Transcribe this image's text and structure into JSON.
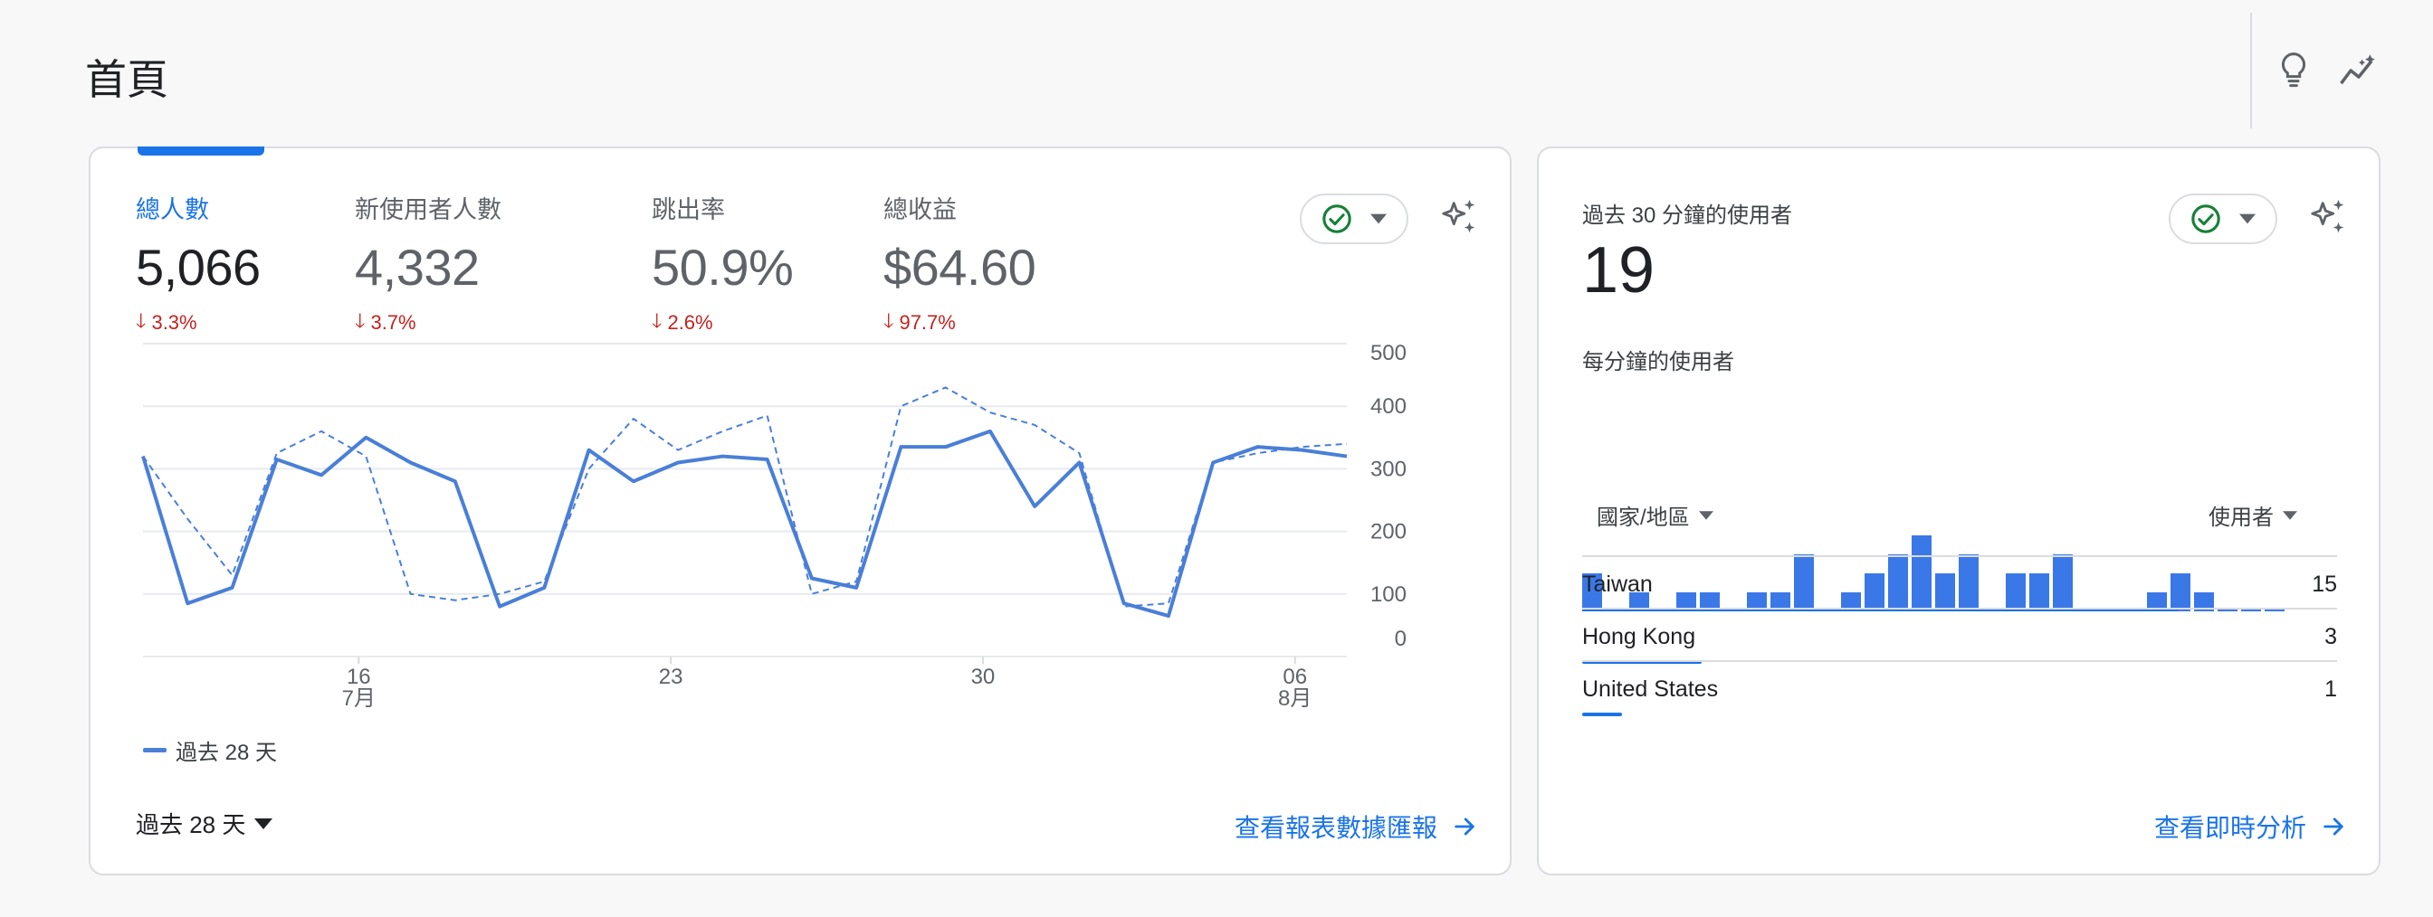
{
  "page": {
    "title": "首頁"
  },
  "header": {
    "icons": [
      "lightbulb-icon",
      "insights-icon"
    ]
  },
  "overview": {
    "metrics": [
      {
        "label": "總人數",
        "value": "5,066",
        "delta": "3.3%",
        "direction": "down",
        "active": true
      },
      {
        "label": "新使用者人數",
        "value": "4,332",
        "delta": "3.7%",
        "direction": "down",
        "active": false
      },
      {
        "label": "跳出率",
        "value": "50.9%",
        "delta": "2.6%",
        "direction": "down",
        "active": false
      },
      {
        "label": "總收益",
        "value": "$64.60",
        "delta": "97.7%",
        "direction": "down",
        "active": false
      }
    ],
    "legend": "過去 28 天",
    "date_range": "過去 28 天",
    "footer_link": "查看報表數據匯報"
  },
  "chart_data": {
    "type": "line",
    "x_tick_labels": [
      {
        "day": "16",
        "month": "7月"
      },
      {
        "day": "23",
        "month": ""
      },
      {
        "day": "30",
        "month": ""
      },
      {
        "day": "06",
        "month": "8月"
      }
    ],
    "y_ticks": [
      "500",
      "400",
      "300",
      "200",
      "100",
      "0"
    ],
    "ylim": [
      0,
      500
    ],
    "grid": true,
    "series": [
      {
        "name": "過去 28 天",
        "style": "solid",
        "values": [
          320,
          85,
          110,
          315,
          290,
          350,
          310,
          280,
          80,
          110,
          330,
          280,
          310,
          320,
          315,
          125,
          110,
          335,
          335,
          360,
          240,
          310,
          85,
          65,
          310,
          335,
          330,
          320
        ]
      },
      {
        "style": "dashed",
        "values": [
          320,
          220,
          130,
          325,
          360,
          320,
          100,
          90,
          100,
          120,
          300,
          380,
          330,
          360,
          385,
          100,
          120,
          400,
          430,
          390,
          370,
          325,
          80,
          85,
          310,
          325,
          335,
          340
        ]
      }
    ]
  },
  "realtime": {
    "label": "過去 30 分鐘的使用者",
    "value": "19",
    "per_minute_label": "每分鐘的使用者",
    "per_minute": [
      2,
      0,
      1,
      0,
      1,
      1,
      0,
      1,
      1,
      3,
      0,
      1,
      2,
      3,
      4,
      2,
      3,
      0,
      2,
      2,
      3,
      0,
      0,
      0,
      1,
      2,
      1,
      0,
      0,
      0
    ],
    "col_country": "國家/地區",
    "col_users": "使用者",
    "rows": [
      {
        "name": "Taiwan",
        "value": "15",
        "count": 15
      },
      {
        "name": "Hong Kong",
        "value": "3",
        "count": 3
      },
      {
        "name": "United States",
        "value": "1",
        "count": 1
      }
    ],
    "footer_link": "查看即時分析"
  },
  "colors": {
    "accent": "#1a73e8",
    "line": "#4a7fd8",
    "negative": "#c5221f",
    "check": "#188038"
  }
}
